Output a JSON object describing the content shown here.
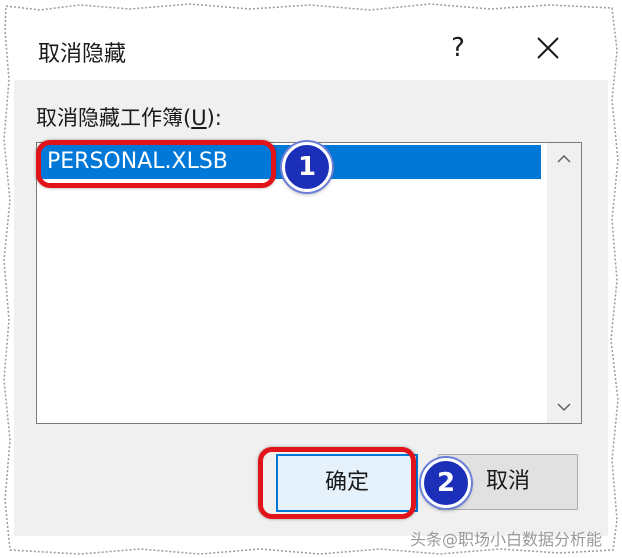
{
  "dialog": {
    "title": "取消隐藏",
    "help_label": "?",
    "close_icon": "close-icon"
  },
  "list": {
    "label_prefix": "取消隐藏工作簿(",
    "label_accel": "U",
    "label_suffix": "):",
    "items": [
      {
        "label": "PERSONAL.XLSB",
        "selected": true
      }
    ],
    "scroll_up_icon": "chevron-up-icon",
    "scroll_down_icon": "chevron-down-icon"
  },
  "buttons": {
    "ok_label": "确定",
    "cancel_label": "取消"
  },
  "annotations": {
    "badge_1": "1",
    "badge_2": "2",
    "ring_color": "#e0141a",
    "badge_color": "#1b2fb8"
  },
  "watermark": "头条@职场小白数据分析能"
}
